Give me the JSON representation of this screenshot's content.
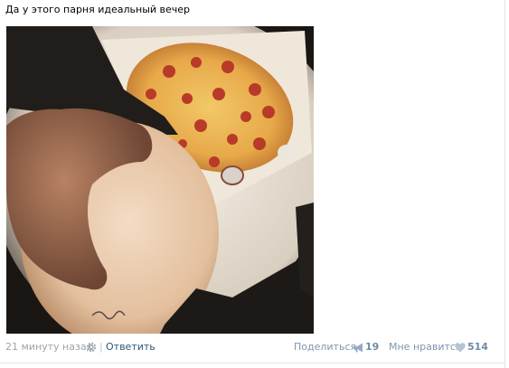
{
  "post": {
    "text": "Да у этого парня идеальный вечер",
    "photo_alt": "photo"
  },
  "footer": {
    "timestamp": "21 минуту назад",
    "separator": "|",
    "reply_label": "Ответить",
    "share_label": "Поделиться",
    "share_count": "19",
    "like_label": "Мне нравится",
    "like_count": "514"
  },
  "icons": {
    "settings": "gear-icon",
    "share": "megaphone-icon",
    "like": "heart-icon"
  },
  "colors": {
    "link": "#2b587a",
    "muted": "#9ca3ab",
    "action": "#7d95ad"
  }
}
